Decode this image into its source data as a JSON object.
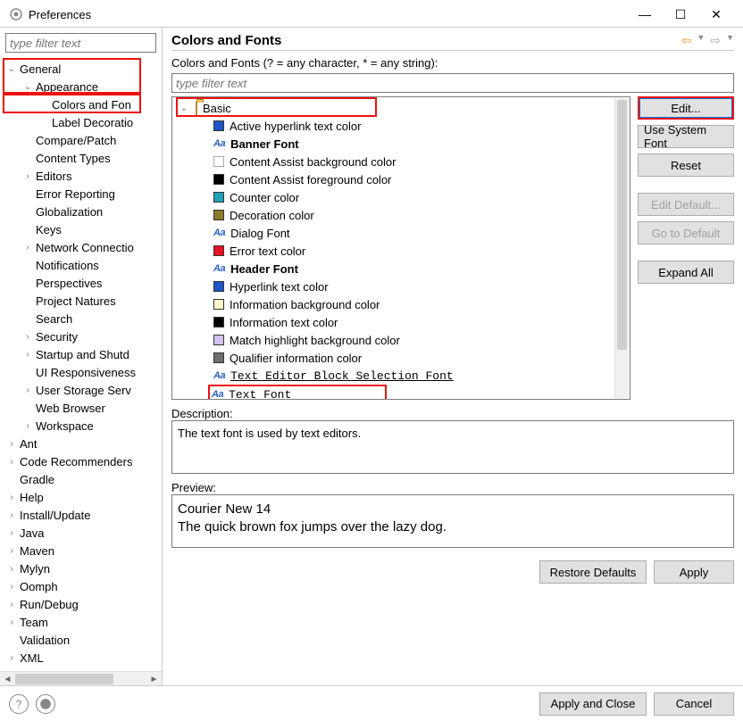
{
  "window": {
    "title": "Preferences"
  },
  "sidebar": {
    "filter_placeholder": "type filter text",
    "nodes": [
      {
        "label": "General",
        "depth": 0,
        "expand": "v"
      },
      {
        "label": "Appearance",
        "depth": 1,
        "expand": "v"
      },
      {
        "label": "Colors and Fon",
        "depth": 2,
        "expand": ""
      },
      {
        "label": "Label Decoratio",
        "depth": 2,
        "expand": ""
      },
      {
        "label": "Compare/Patch",
        "depth": 1,
        "expand": ""
      },
      {
        "label": "Content Types",
        "depth": 1,
        "expand": ""
      },
      {
        "label": "Editors",
        "depth": 1,
        "expand": ">"
      },
      {
        "label": "Error Reporting",
        "depth": 1,
        "expand": ""
      },
      {
        "label": "Globalization",
        "depth": 1,
        "expand": ""
      },
      {
        "label": "Keys",
        "depth": 1,
        "expand": ""
      },
      {
        "label": "Network Connectio",
        "depth": 1,
        "expand": ">"
      },
      {
        "label": "Notifications",
        "depth": 1,
        "expand": ""
      },
      {
        "label": "Perspectives",
        "depth": 1,
        "expand": ""
      },
      {
        "label": "Project Natures",
        "depth": 1,
        "expand": ""
      },
      {
        "label": "Search",
        "depth": 1,
        "expand": ""
      },
      {
        "label": "Security",
        "depth": 1,
        "expand": ">"
      },
      {
        "label": "Startup and Shutd",
        "depth": 1,
        "expand": ">"
      },
      {
        "label": "UI Responsiveness",
        "depth": 1,
        "expand": ""
      },
      {
        "label": "User Storage Serv",
        "depth": 1,
        "expand": ">"
      },
      {
        "label": "Web Browser",
        "depth": 1,
        "expand": ""
      },
      {
        "label": "Workspace",
        "depth": 1,
        "expand": ">"
      },
      {
        "label": "Ant",
        "depth": 0,
        "expand": ">"
      },
      {
        "label": "Code Recommenders",
        "depth": 0,
        "expand": ">"
      },
      {
        "label": "Gradle",
        "depth": 0,
        "expand": ""
      },
      {
        "label": "Help",
        "depth": 0,
        "expand": ">"
      },
      {
        "label": "Install/Update",
        "depth": 0,
        "expand": ">"
      },
      {
        "label": "Java",
        "depth": 0,
        "expand": ">"
      },
      {
        "label": "Maven",
        "depth": 0,
        "expand": ">"
      },
      {
        "label": "Mylyn",
        "depth": 0,
        "expand": ">"
      },
      {
        "label": "Oomph",
        "depth": 0,
        "expand": ">"
      },
      {
        "label": "Run/Debug",
        "depth": 0,
        "expand": ">"
      },
      {
        "label": "Team",
        "depth": 0,
        "expand": ">"
      },
      {
        "label": "Validation",
        "depth": 0,
        "expand": ""
      },
      {
        "label": "XML",
        "depth": 0,
        "expand": ">"
      }
    ]
  },
  "page": {
    "title": "Colors and Fonts",
    "subtitle": "Colors and Fonts (? = any character, * = any string):",
    "filter_placeholder": "type filter text",
    "basic_label": "Basic",
    "items": [
      {
        "label": "Active hyperlink text color",
        "type": "color",
        "color": "#1e55c7"
      },
      {
        "label": "Banner Font",
        "type": "font",
        "bold": true,
        "aa_color": "#2b63c0"
      },
      {
        "label": "Content Assist background color",
        "type": "color",
        "color": "#ffffff"
      },
      {
        "label": "Content Assist foreground color",
        "type": "color",
        "color": "#000000"
      },
      {
        "label": "Counter color",
        "type": "color",
        "color": "#1fa2b5"
      },
      {
        "label": "Decoration color",
        "type": "color",
        "color": "#8a7a2a"
      },
      {
        "label": "Dialog Font",
        "type": "font",
        "bold": false,
        "aa_color": "#2b63c0"
      },
      {
        "label": "Error text color",
        "type": "color",
        "color": "#e81123"
      },
      {
        "label": "Header Font",
        "type": "font",
        "bold": true,
        "aa_color": "#2b63c0"
      },
      {
        "label": "Hyperlink text color",
        "type": "color",
        "color": "#1e55c7"
      },
      {
        "label": "Information background color",
        "type": "color",
        "color": "#fff7cc"
      },
      {
        "label": "Information text color",
        "type": "color",
        "color": "#000000"
      },
      {
        "label": "Match highlight background color",
        "type": "color",
        "color": "#d0c3ef"
      },
      {
        "label": "Qualifier information color",
        "type": "color",
        "color": "#6e6e6e"
      },
      {
        "label": "Text Editor Block Selection Font",
        "type": "font",
        "bold": false,
        "aa_color": "#2b63c0",
        "underline": true
      }
    ],
    "selected": {
      "label": "Text Font",
      "aa_color": "#2b63c0"
    },
    "buttons": {
      "edit": "Edit...",
      "use_system_font": "Use System Font",
      "reset": "Reset",
      "edit_default": "Edit Default...",
      "go_to_default": "Go to Default",
      "expand_all": "Expand All"
    },
    "description_label": "Description:",
    "description_text": "The text font is used by text editors.",
    "preview_label": "Preview:",
    "preview_line1": "Courier New 14",
    "preview_line2": "The quick brown fox jumps over the lazy dog.",
    "restore_defaults": "Restore Defaults",
    "apply": "Apply"
  },
  "footer": {
    "apply_close": "Apply and Close",
    "cancel": "Cancel"
  }
}
